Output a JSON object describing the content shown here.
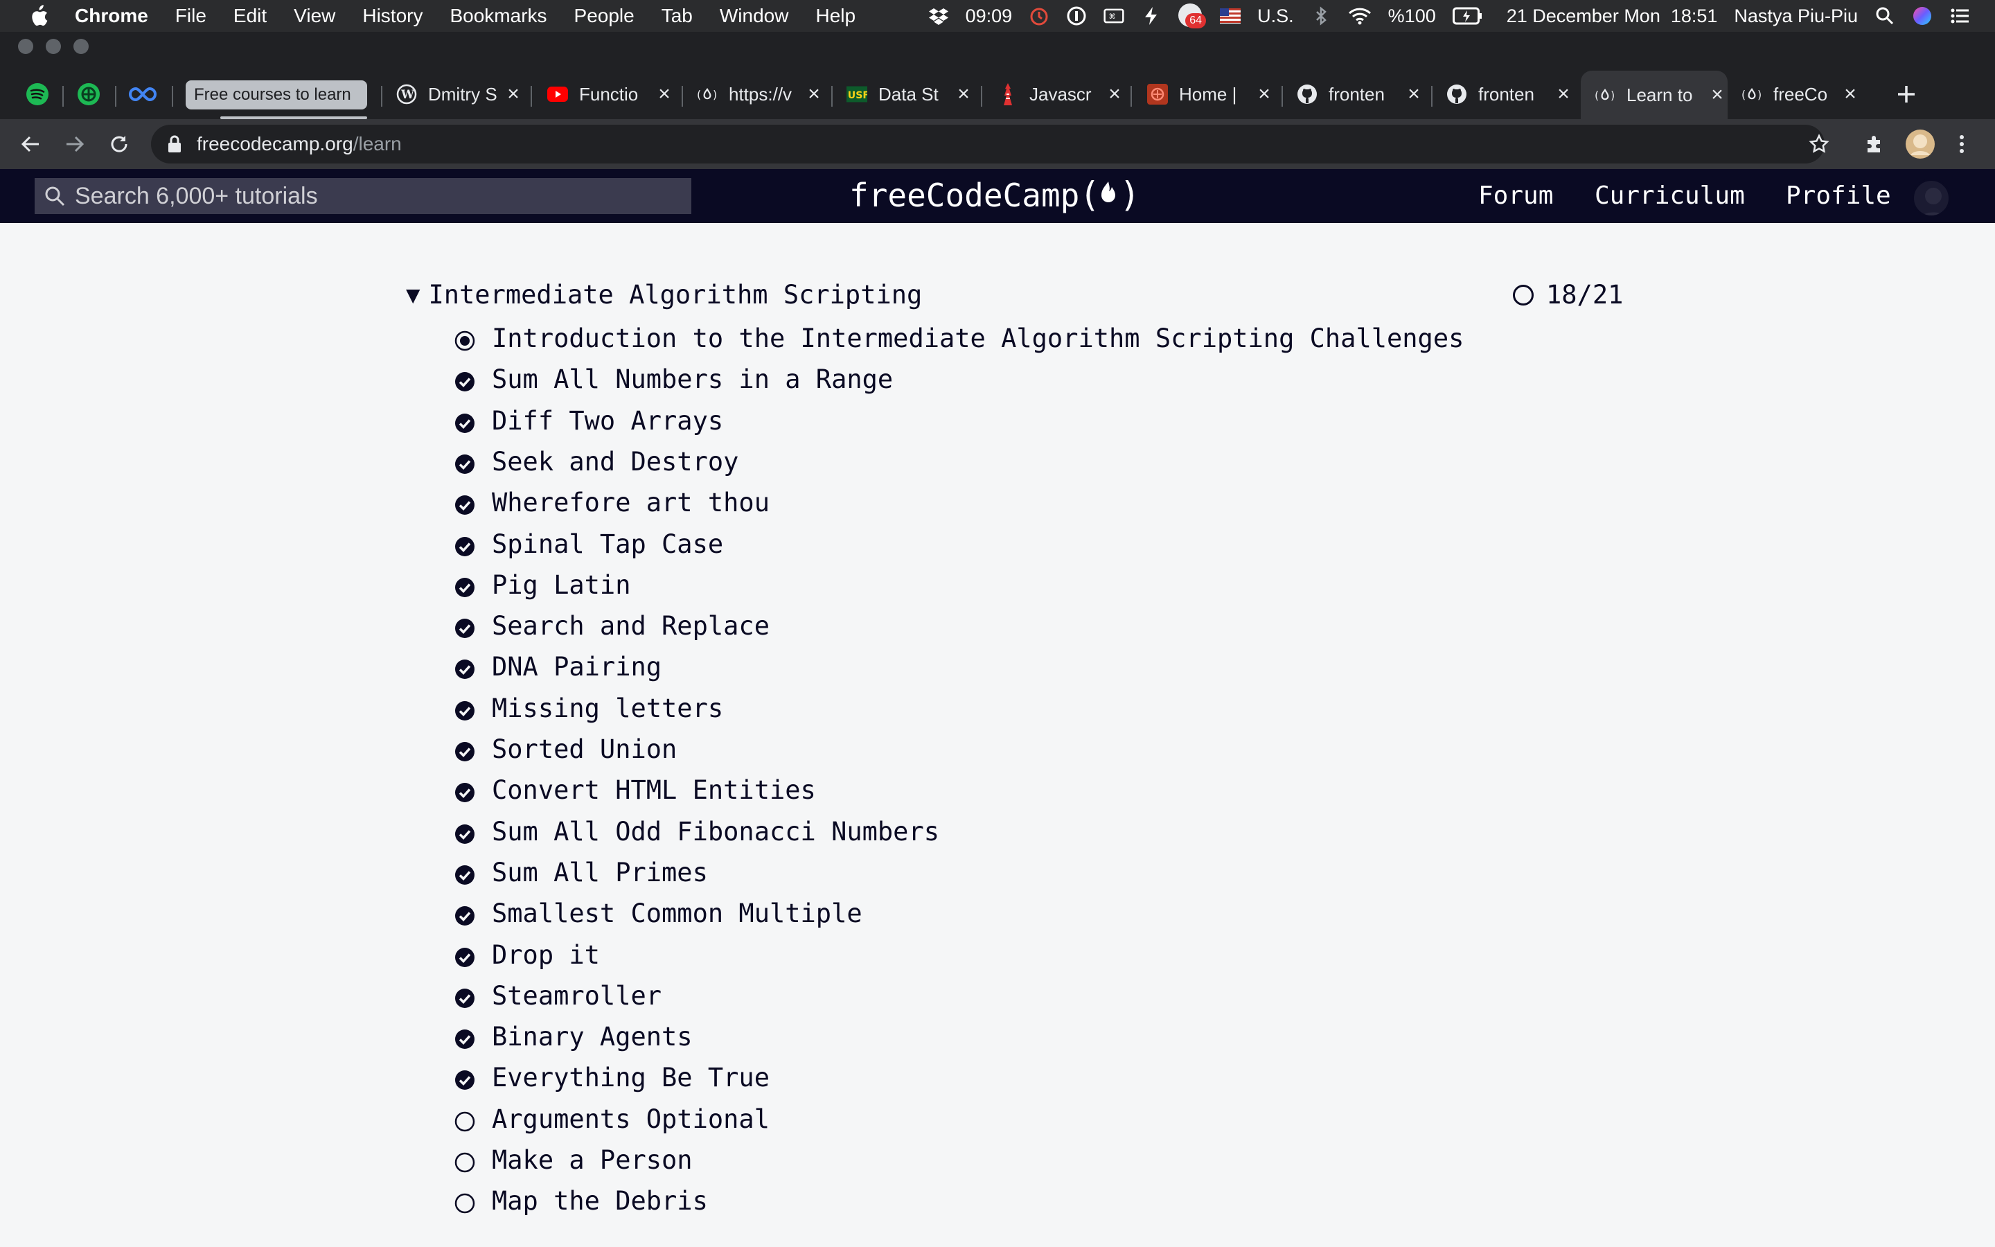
{
  "menubar": {
    "app_name": "Chrome",
    "items": [
      "File",
      "Edit",
      "View",
      "History",
      "Bookmarks",
      "People",
      "Tab",
      "Window",
      "Help"
    ],
    "status": {
      "dropbox_time": "09:09",
      "notification_count": "64",
      "input_source": "U.S.",
      "battery": "%100",
      "datetime": "21 December Mon  18:51",
      "user": "Nastya Piu-Piu"
    }
  },
  "tabs": {
    "pinned": [
      {
        "icon": "spotify-icon",
        "color": "#1db954"
      },
      {
        "icon": "app-icon",
        "color": "#1db954"
      },
      {
        "icon": "infinity-icon",
        "color": "#4285f4"
      }
    ],
    "group_label": "Free courses to learn",
    "list": [
      {
        "title": "Dmitry S",
        "icon": "wordpress-icon"
      },
      {
        "title": "Functio",
        "icon": "youtube-icon"
      },
      {
        "title": "https://v",
        "icon": "freecodecamp-icon"
      },
      {
        "title": "Data St",
        "icon": "usf-icon"
      },
      {
        "title": "Javascr",
        "icon": "tower-icon"
      },
      {
        "title": "Home |",
        "icon": "codewars-icon"
      },
      {
        "title": "fronten",
        "icon": "github-icon"
      },
      {
        "title": "fronten",
        "icon": "github-icon"
      },
      {
        "title": "Learn to",
        "icon": "freecodecamp-icon",
        "active": true
      },
      {
        "title": "freeCo",
        "icon": "freecodecamp-icon"
      }
    ]
  },
  "toolbar": {
    "url_host": "freecodecamp.org",
    "url_path": "/learn"
  },
  "fcc_nav": {
    "search_placeholder": "Search 6,000+ tutorials",
    "logo": "freeCodeCamp",
    "links": [
      "Forum",
      "Curriculum",
      "Profile"
    ]
  },
  "block": {
    "title": "Intermediate Algorithm Scripting",
    "progress": "18/21",
    "challenges": [
      {
        "title": "Introduction to the Intermediate Algorithm Scripting Challenges",
        "status": "current"
      },
      {
        "title": "Sum All Numbers in a Range",
        "status": "completed"
      },
      {
        "title": "Diff Two Arrays",
        "status": "completed"
      },
      {
        "title": "Seek and Destroy",
        "status": "completed"
      },
      {
        "title": "Wherefore art thou",
        "status": "completed"
      },
      {
        "title": "Spinal Tap Case",
        "status": "completed"
      },
      {
        "title": "Pig Latin",
        "status": "completed"
      },
      {
        "title": "Search and Replace",
        "status": "completed"
      },
      {
        "title": "DNA Pairing",
        "status": "completed"
      },
      {
        "title": "Missing letters",
        "status": "completed"
      },
      {
        "title": "Sorted Union",
        "status": "completed"
      },
      {
        "title": "Convert HTML Entities",
        "status": "completed"
      },
      {
        "title": "Sum All Odd Fibonacci Numbers",
        "status": "completed"
      },
      {
        "title": "Sum All Primes",
        "status": "completed"
      },
      {
        "title": "Smallest Common Multiple",
        "status": "completed"
      },
      {
        "title": "Drop it",
        "status": "completed"
      },
      {
        "title": "Steamroller",
        "status": "completed"
      },
      {
        "title": "Binary Agents",
        "status": "completed"
      },
      {
        "title": "Everything Be True",
        "status": "completed"
      },
      {
        "title": "Arguments Optional",
        "status": "incomplete"
      },
      {
        "title": "Make a Person",
        "status": "incomplete"
      },
      {
        "title": "Map the Debris",
        "status": "incomplete"
      }
    ]
  }
}
